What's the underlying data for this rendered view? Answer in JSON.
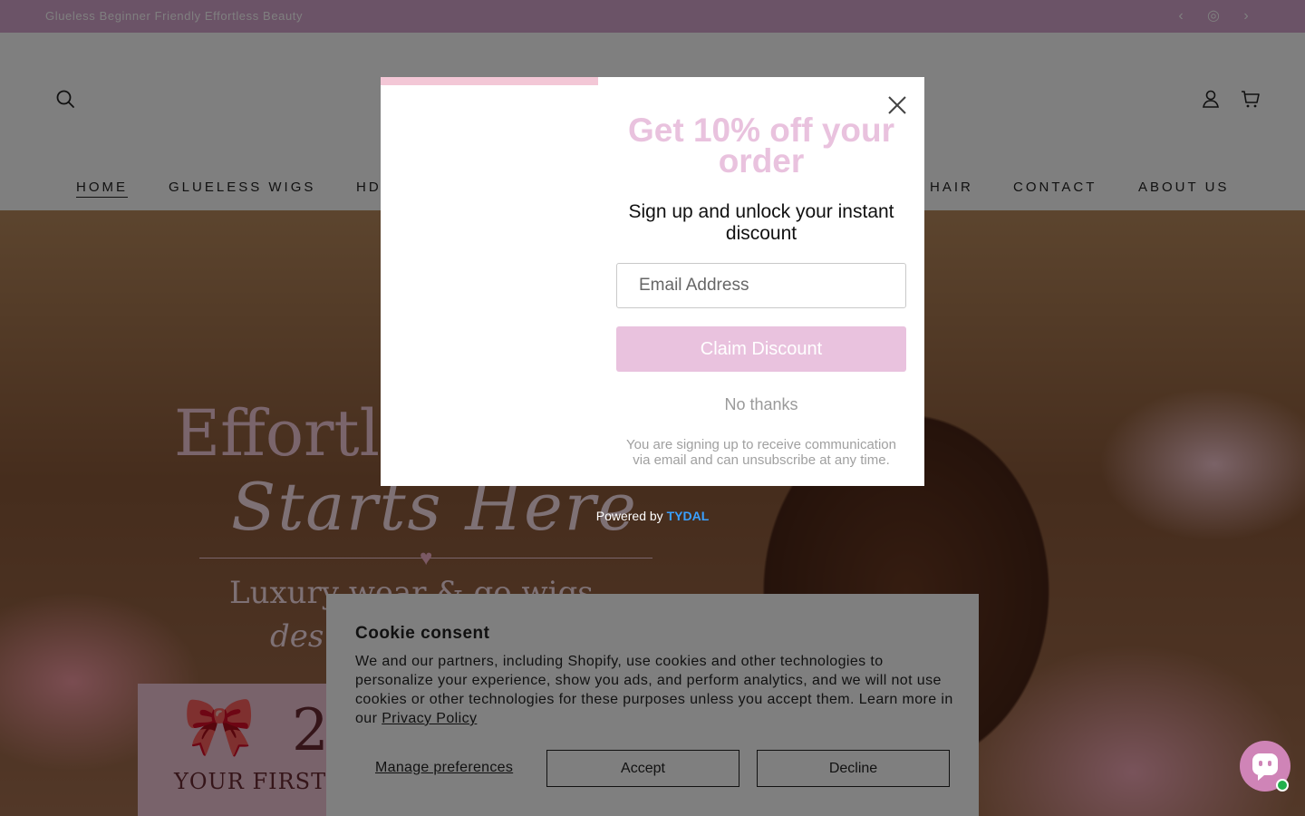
{
  "announcement": {
    "text": "Glueless Beginner Friendly Effortless Beauty"
  },
  "nav": {
    "items": [
      {
        "label": "HOME"
      },
      {
        "label": "GLUELESS WIGS"
      },
      {
        "label": "HD"
      },
      {
        "label": "HAIR"
      },
      {
        "label": "CONTACT"
      },
      {
        "label": "ABOUT US"
      }
    ]
  },
  "hero": {
    "title": "Effortle",
    "script": "Starts Here",
    "sub": "Luxury wear & go wigs",
    "sub2": "des",
    "promo_number": "2",
    "promo_text": "YOUR FIRST O"
  },
  "popup": {
    "title": "Get 10% off your order",
    "subtitle": "Sign up and unlock your instant discount",
    "email_placeholder": "Email Address",
    "claim_label": "Claim Discount",
    "no_thanks": "No thanks",
    "legal": "You are signing up to receive communication via email and can unsubscribe at any time.",
    "powered_prefix": "Powered by",
    "powered_brand": "TYDAL",
    "accent_color": "#e9c2de"
  },
  "cookie": {
    "title": "Cookie consent",
    "body": "We and our partners, including Shopify, use cookies and other technologies to personalize your experience, show you ads, and perform analytics, and we will not use cookies or other technologies for these purposes unless you accept them. Learn more in our",
    "link": "Privacy Policy",
    "manage": "Manage preferences",
    "accept": "Accept",
    "decline": "Decline"
  },
  "icons": {
    "search": "search-icon",
    "account": "account-icon",
    "cart": "cart-icon",
    "close": "close-icon",
    "chat": "chat-icon"
  }
}
